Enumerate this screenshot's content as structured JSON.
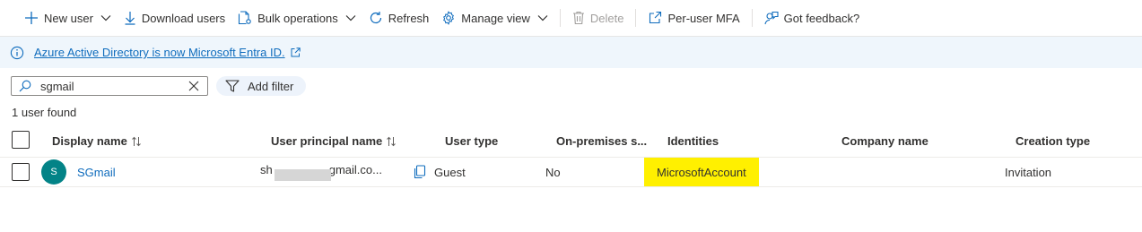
{
  "toolbar": {
    "new_user": "New user",
    "download_users": "Download users",
    "bulk_operations": "Bulk operations",
    "refresh": "Refresh",
    "manage_view": "Manage view",
    "delete": "Delete",
    "per_user_mfa": "Per-user MFA",
    "got_feedback": "Got feedback?"
  },
  "banner": {
    "link_text": "Azure Active Directory is now Microsoft Entra ID."
  },
  "search": {
    "value": "sgmail"
  },
  "filter": {
    "add_filter": "Add filter"
  },
  "result_count": "1 user found",
  "table": {
    "columns": {
      "display_name": "Display name",
      "user_principal_name": "User principal name",
      "user_type": "User type",
      "on_premises": "On-premises s...",
      "identities": "Identities",
      "company_name": "Company name",
      "creation_type": "Creation type"
    },
    "rows": [
      {
        "avatar_initial": "S",
        "display_name": "SGmail",
        "upn_start": "sh",
        "upn_end": "gmail.co...",
        "user_type": "Guest",
        "on_premises": "No",
        "identities": "MicrosoftAccount",
        "company_name": "",
        "creation_type": "Invitation"
      }
    ]
  },
  "colors": {
    "accent": "#0f6cbd",
    "banner_bg": "#eff6fc",
    "avatar_bg": "#038387",
    "highlight": "#fff000"
  }
}
